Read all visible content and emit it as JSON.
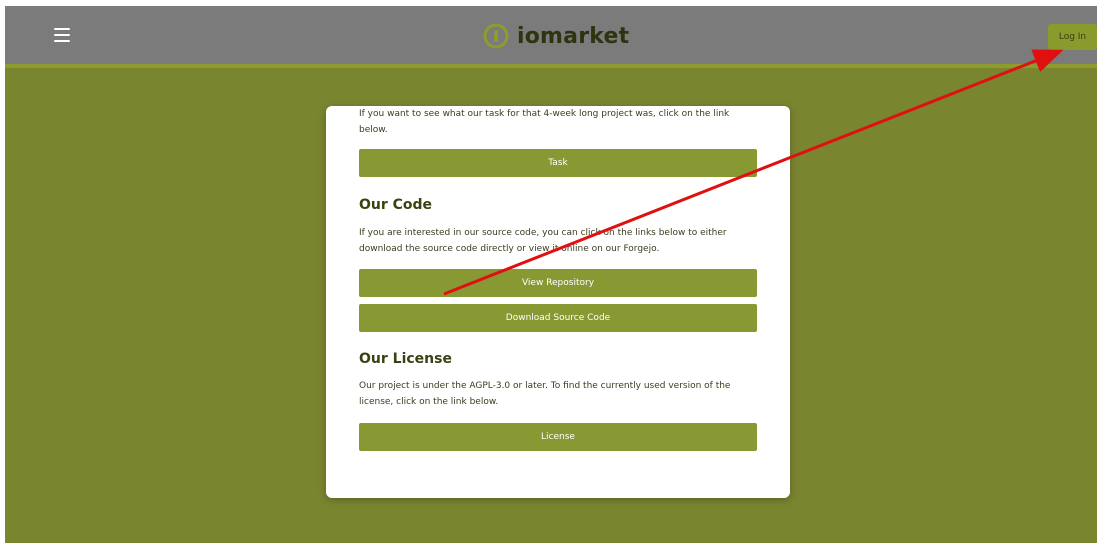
{
  "header": {
    "brand": "iomarket",
    "menu_icon": "hamburger-menu-icon",
    "login_label": "Log In"
  },
  "card": {
    "intro_text": "If you want to see what our task for that 4-week long project was, click on the link below.",
    "task_button": "Task",
    "code_heading": "Our Code",
    "code_text": "If you are interested in our source code, you can click on the links below to either download the source code directly or view it online on our Forgejo.",
    "view_repo_button": "View Repository",
    "download_button": "Download Source Code",
    "license_heading": "Our License",
    "license_text": "Our project is under the AGPL-3.0 or later. To find the currently used version of the license, click on the link below.",
    "license_button": "License"
  },
  "colors": {
    "page_bg": "#7a8530",
    "header_bg": "#7b7b7b",
    "button_bg": "#889832",
    "annotation_arrow": "#e01010"
  }
}
